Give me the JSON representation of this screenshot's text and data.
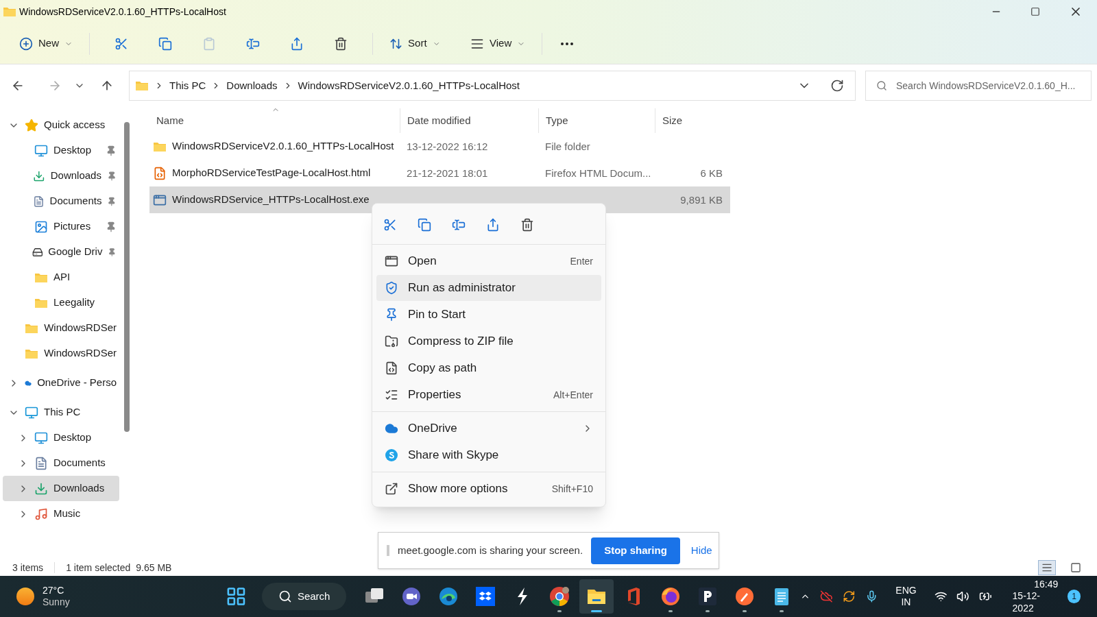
{
  "window": {
    "title": "WindowsRDServiceV2.0.1.60_HTTPs-LocalHost"
  },
  "toolbar": {
    "new_label": "New",
    "actions": [
      {
        "kind": "cut",
        "disabled": false
      },
      {
        "kind": "copy",
        "disabled": false
      },
      {
        "kind": "paste",
        "disabled": true
      },
      {
        "kind": "rename",
        "disabled": false
      },
      {
        "kind": "share",
        "disabled": false
      },
      {
        "kind": "delete",
        "disabled": false
      }
    ],
    "sort_label": "Sort",
    "view_label": "View"
  },
  "address": {
    "path": [
      "This PC",
      "Downloads",
      "WindowsRDServiceV2.0.1.60_HTTPs-LocalHost"
    ],
    "search_placeholder": "Search WindowsRDServiceV2.0.1.60_H..."
  },
  "sidebar": {
    "items": [
      {
        "label": "Quick access",
        "kind": "star",
        "expanded": true,
        "selected": false,
        "children": [
          {
            "label": "Desktop",
            "kind": "desktop",
            "pinned": true,
            "selected": false
          },
          {
            "label": "Downloads",
            "kind": "download",
            "pinned": true,
            "selected": false
          },
          {
            "label": "Documents",
            "kind": "documents",
            "pinned": true,
            "selected": false
          },
          {
            "label": "Pictures",
            "kind": "pictures",
            "pinned": true,
            "selected": false
          },
          {
            "label": "Google Driv",
            "kind": "drive",
            "pinned": true,
            "selected": false
          },
          {
            "label": "API",
            "kind": "folder",
            "pinned": false,
            "selected": false
          },
          {
            "label": "Leegality",
            "kind": "folder",
            "pinned": false,
            "selected": false
          },
          {
            "label": "WindowsRDSer",
            "kind": "folder",
            "pinned": false,
            "selected": false
          },
          {
            "label": "WindowsRDSer",
            "kind": "folder",
            "pinned": false,
            "selected": false
          }
        ]
      },
      {
        "label": "OneDrive - Perso",
        "kind": "cloud",
        "expanded": false,
        "selected": false
      },
      {
        "label": "This PC",
        "kind": "pc",
        "expanded": true,
        "selected": false,
        "children": [
          {
            "label": "Desktop",
            "kind": "desktop",
            "expanded": false,
            "selected": false
          },
          {
            "label": "Documents",
            "kind": "documents",
            "expanded": false,
            "selected": false
          },
          {
            "label": "Downloads",
            "kind": "download",
            "expanded": false,
            "selected": true
          },
          {
            "label": "Music",
            "kind": "music",
            "expanded": false,
            "selected": false
          }
        ]
      }
    ]
  },
  "table": {
    "columns": [
      {
        "label": "Name",
        "sorted": true
      },
      {
        "label": "Date modified",
        "sorted": false
      },
      {
        "label": "Type",
        "sorted": false
      },
      {
        "label": "Size",
        "sorted": false
      }
    ],
    "rows": [
      {
        "kind": "folder",
        "name": "WindowsRDServiceV2.0.1.60_HTTPs-LocalHost",
        "date": "13-12-2022 16:12",
        "type": "File folder",
        "selected": false
      },
      {
        "kind": "html",
        "name": "MorphoRDServiceTestPage-LocalHost.html",
        "date": "21-12-2021 18:01",
        "type": "Firefox HTML Docum...",
        "size": "6 KB",
        "selected": false
      },
      {
        "kind": "exe",
        "name": "WindowsRDService_HTTPs-LocalHost.exe",
        "size": "9,891 KB",
        "selected": true
      }
    ]
  },
  "context_menu": {
    "quick_actions": [
      {
        "kind": "cut"
      },
      {
        "kind": "copy"
      },
      {
        "kind": "rename"
      },
      {
        "kind": "share"
      },
      {
        "kind": "delete"
      }
    ],
    "sections": [
      {
        "items": [
          {
            "kind": "open",
            "label": "Open",
            "shortcut": "Enter",
            "selected": false
          },
          {
            "kind": "admin",
            "label": "Run as administrator",
            "selected": true
          },
          {
            "kind": "pin",
            "label": "Pin to Start",
            "selected": false
          },
          {
            "kind": "zip",
            "label": "Compress to ZIP file",
            "selected": false
          },
          {
            "kind": "path",
            "label": "Copy as path",
            "selected": false
          },
          {
            "kind": "properties",
            "label": "Properties",
            "shortcut": "Alt+Enter",
            "selected": false
          }
        ]
      },
      {
        "items": [
          {
            "kind": "onedrive",
            "label": "OneDrive",
            "submenu": true,
            "selected": false
          },
          {
            "kind": "skype",
            "label": "Share with Skype",
            "selected": false
          }
        ]
      },
      {
        "items": [
          {
            "kind": "more",
            "label": "Show more options",
            "shortcut": "Shift+F10",
            "selected": false
          }
        ]
      }
    ]
  },
  "sharing_bar": {
    "message": "meet.google.com is sharing your screen.",
    "stop_label": "Stop sharing",
    "hide_label": "Hide"
  },
  "status_bar": {
    "count": "3 items",
    "selection": "1 item selected",
    "size": "9.65 MB",
    "views": [
      {
        "kind": "details",
        "selected": true
      },
      {
        "kind": "tiles",
        "selected": false
      }
    ]
  },
  "taskbar": {
    "weather": {
      "temp": "27°C",
      "condition": "Sunny"
    },
    "search_label": "Search",
    "apps": [
      {
        "kind": "taskview",
        "running": false,
        "active": false
      },
      {
        "kind": "chat",
        "running": false,
        "active": false
      },
      {
        "kind": "edge",
        "running": false,
        "active": false
      },
      {
        "kind": "dropbox",
        "running": false,
        "active": false
      },
      {
        "kind": "bolt",
        "running": false,
        "active": false
      },
      {
        "kind": "chrome",
        "running": true,
        "active": false
      },
      {
        "kind": "explorer",
        "running": true,
        "active": true
      },
      {
        "kind": "office",
        "running": false,
        "active": false
      },
      {
        "kind": "firefox",
        "running": true,
        "active": false
      },
      {
        "kind": "p",
        "running": true,
        "active": false
      },
      {
        "kind": "postman",
        "running": true,
        "active": false
      },
      {
        "kind": "notepad",
        "running": true,
        "active": false
      }
    ],
    "language": [
      "ENG",
      "IN"
    ],
    "time": "16:49",
    "date": "15-12-2022",
    "notifications": "1"
  }
}
